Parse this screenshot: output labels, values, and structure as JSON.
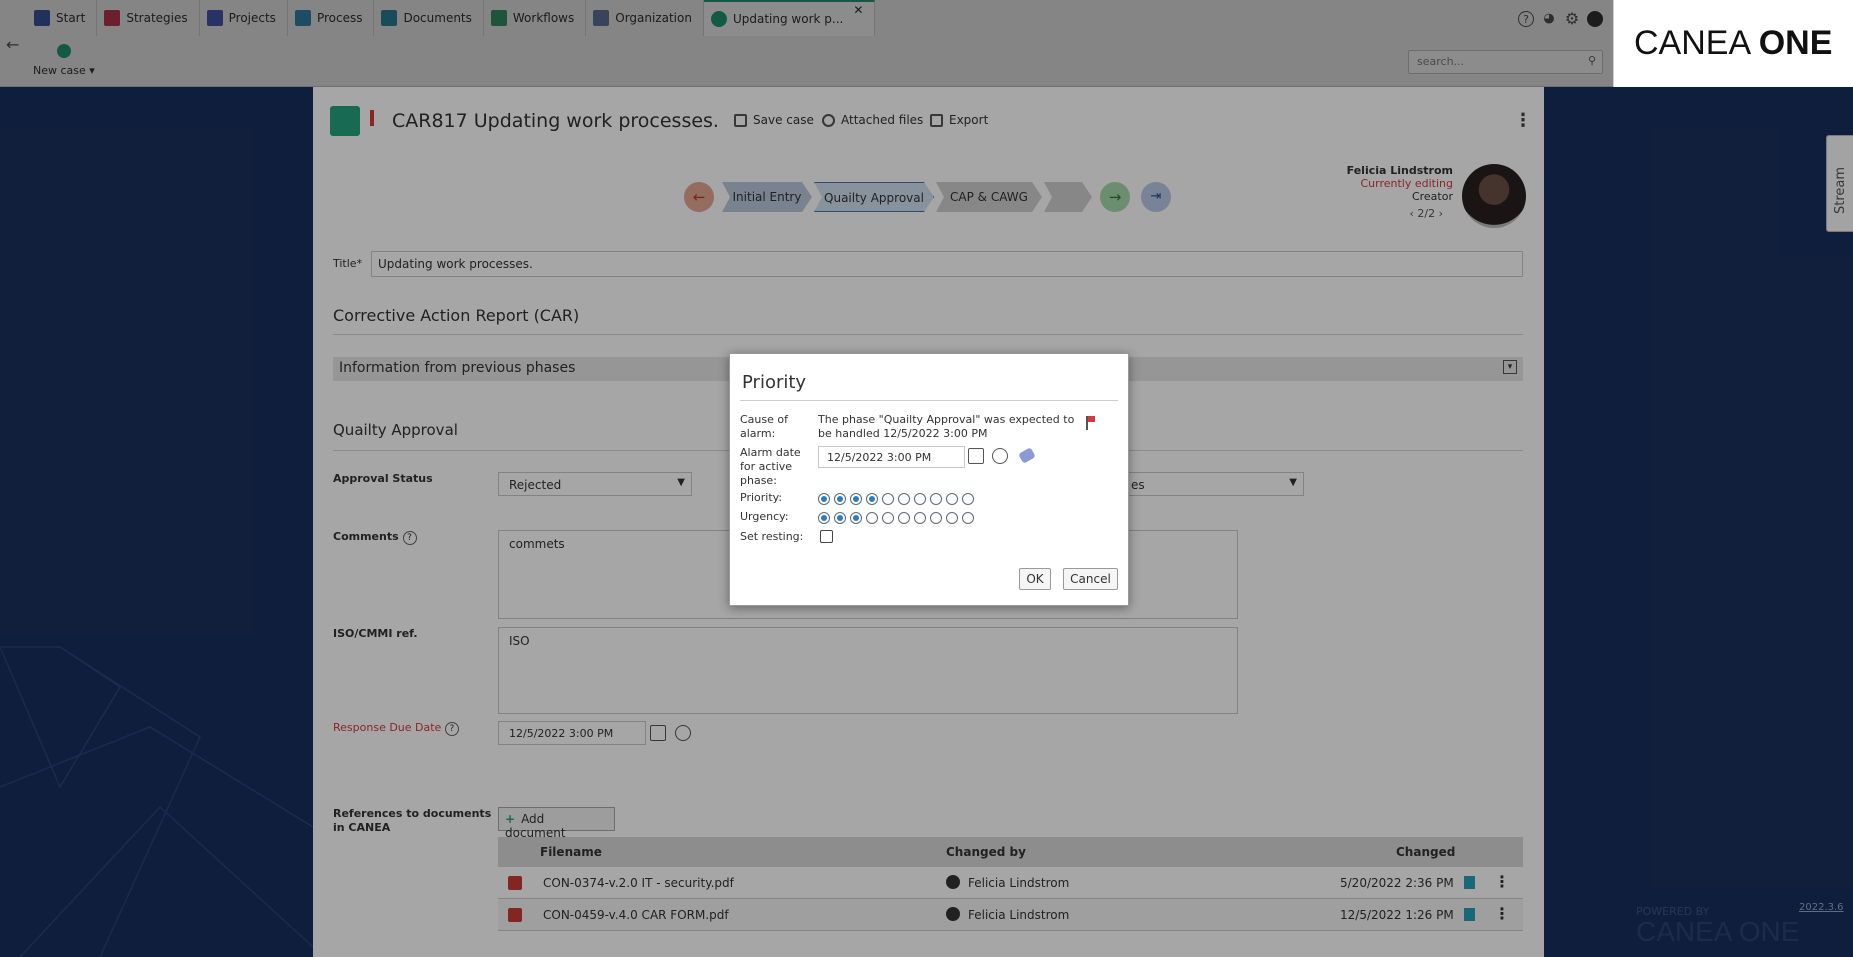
{
  "tabs": [
    {
      "label": "Start",
      "icon": "home-icon",
      "color": "#3a5aa8"
    },
    {
      "label": "Strategies",
      "icon": "strategies-icon",
      "color": "#c23b5a"
    },
    {
      "label": "Projects",
      "icon": "projects-icon",
      "color": "#4a5bb8"
    },
    {
      "label": "Process",
      "icon": "process-icon",
      "color": "#3a8ab8"
    },
    {
      "label": "Documents",
      "icon": "documents-icon",
      "color": "#2a8aa0"
    },
    {
      "label": "Workflows",
      "icon": "workflows-icon",
      "color": "#3a9a6a"
    },
    {
      "label": "Organization",
      "icon": "organization-icon",
      "color": "#6a7aa8"
    },
    {
      "label": "Updating work p...",
      "icon": "case-icon",
      "color": "#25a37e",
      "active": true
    }
  ],
  "toolbar": {
    "new_case_label": "New case",
    "search_placeholder": "search..."
  },
  "brand": {
    "name_light": "CANEA ",
    "name_bold": "ONE"
  },
  "case": {
    "title": "CAR817 Updating work processes.",
    "save_label": "Save case",
    "attached_label": "Attached files",
    "export_label": "Export"
  },
  "workflow": {
    "steps": [
      "Initial Entry",
      "Quailty Approval",
      "CAP & CAWG",
      ""
    ],
    "active_step": "Quailty Approval"
  },
  "user": {
    "name": "Felicia Lindstrom",
    "status": "Currently editing",
    "role": "Creator",
    "pager": "2/2"
  },
  "form": {
    "title_label": "Title*",
    "title_value": "Updating work processes.",
    "report_heading": "Corrective Action Report (CAR)",
    "prev_phases": "Information from previous phases",
    "phase_heading": "Quailty Approval",
    "approval_status_label": "Approval Status",
    "approval_status_value": "Rejected",
    "right_select_value": "es",
    "comments_label": "Comments",
    "comments_value": "commets",
    "iso_label": "ISO/CMMI ref.",
    "iso_value": "ISO",
    "due_label": "Response Due Date",
    "due_value": "12/5/2022 3:00 PM",
    "refs_label": "References to documents in CANEA",
    "add_document_label": "Add document"
  },
  "documents": {
    "headers": {
      "filename": "Filename",
      "changed_by": "Changed by",
      "changed": "Changed"
    },
    "rows": [
      {
        "filename": "CON-0374-v.2.0 IT - security.pdf",
        "changed_by": "Felicia Lindstrom",
        "changed": "5/20/2022 2:36 PM"
      },
      {
        "filename": "CON-0459-v.4.0 CAR FORM.pdf",
        "changed_by": "Felicia Lindstrom",
        "changed": "12/5/2022 1:26 PM"
      }
    ]
  },
  "stream_label": "Stream",
  "footer": {
    "powered": "POWERED BY",
    "brand": "CANEA ONE",
    "version": "2022.3.6"
  },
  "modal": {
    "title": "Priority",
    "cause_label": "Cause of alarm:",
    "cause_value": "The phase \"Quailty Approval\" was expected to be handled 12/5/2022 3:00 PM",
    "alarm_label": "Alarm date for active phase:",
    "alarm_value": "12/5/2022 3:00 PM",
    "priority_label": "Priority:",
    "priority_level": 4,
    "urgency_label": "Urgency:",
    "urgency_level": 3,
    "scale_max": 10,
    "resting_label": "Set resting:",
    "resting_checked": false,
    "ok_label": "OK",
    "cancel_label": "Cancel"
  }
}
